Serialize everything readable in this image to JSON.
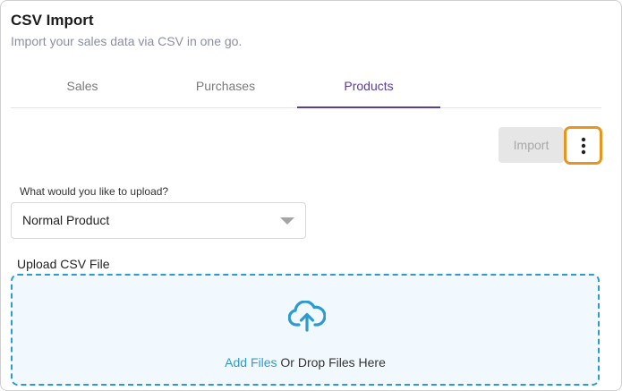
{
  "header": {
    "title": "CSV Import",
    "subtitle": "Import your sales data via CSV in one go."
  },
  "tabs": [
    {
      "label": "Sales",
      "active": false
    },
    {
      "label": "Purchases",
      "active": false
    },
    {
      "label": "Products",
      "active": true
    }
  ],
  "toolbar": {
    "import_label": "Import",
    "import_enabled": false,
    "more_icon": "kebab-vertical-icon"
  },
  "upload_type": {
    "label": "What would you like to upload?",
    "selected": "Normal Product"
  },
  "upload": {
    "label": "Upload CSV File",
    "add_files_label": "Add Files",
    "drop_text": "Or Drop Files Here",
    "icon": "cloud-upload-icon"
  },
  "colors": {
    "accent": "#5b3d9a",
    "link": "#2e9bd0",
    "highlight": "#e8951e"
  }
}
